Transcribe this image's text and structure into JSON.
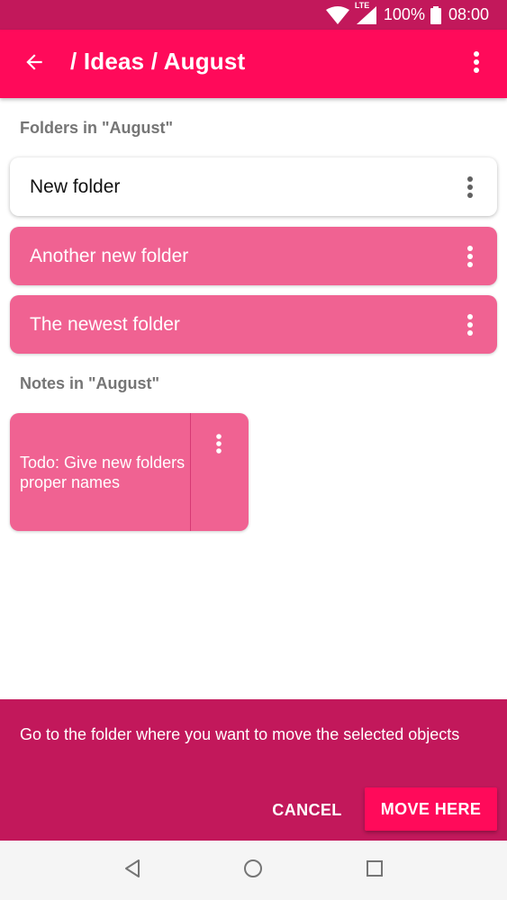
{
  "status_bar": {
    "network_label": "LTE",
    "battery": "100%",
    "time": "08:00",
    "icons": [
      "wifi-icon",
      "lte-signal-icon",
      "battery-icon"
    ]
  },
  "app_bar": {
    "title": "/ Ideas / August",
    "back_icon": "arrow-back-icon",
    "menu_icon": "more-vert-icon"
  },
  "folders_section": {
    "header": "Folders in \"August\"",
    "items": [
      {
        "label": "New folder",
        "style": "white"
      },
      {
        "label": "Another new folder",
        "style": "pink"
      },
      {
        "label": "The newest folder",
        "style": "pink"
      }
    ]
  },
  "notes_section": {
    "header": "Notes in \"August\"",
    "items": [
      {
        "text": "Todo: Give new folders proper names"
      }
    ]
  },
  "move_panel": {
    "message": "Go to the folder where you want to move the selected objects",
    "cancel_label": "CANCEL",
    "move_label": "MOVE HERE"
  },
  "nav_bar": {
    "icons": [
      "nav-back-icon",
      "nav-home-icon",
      "nav-recents-icon"
    ]
  },
  "colors": {
    "primary": "#ff0a5a",
    "primary_dark": "#c2185b",
    "card_pink": "#f06292",
    "header_gray": "#757575"
  }
}
